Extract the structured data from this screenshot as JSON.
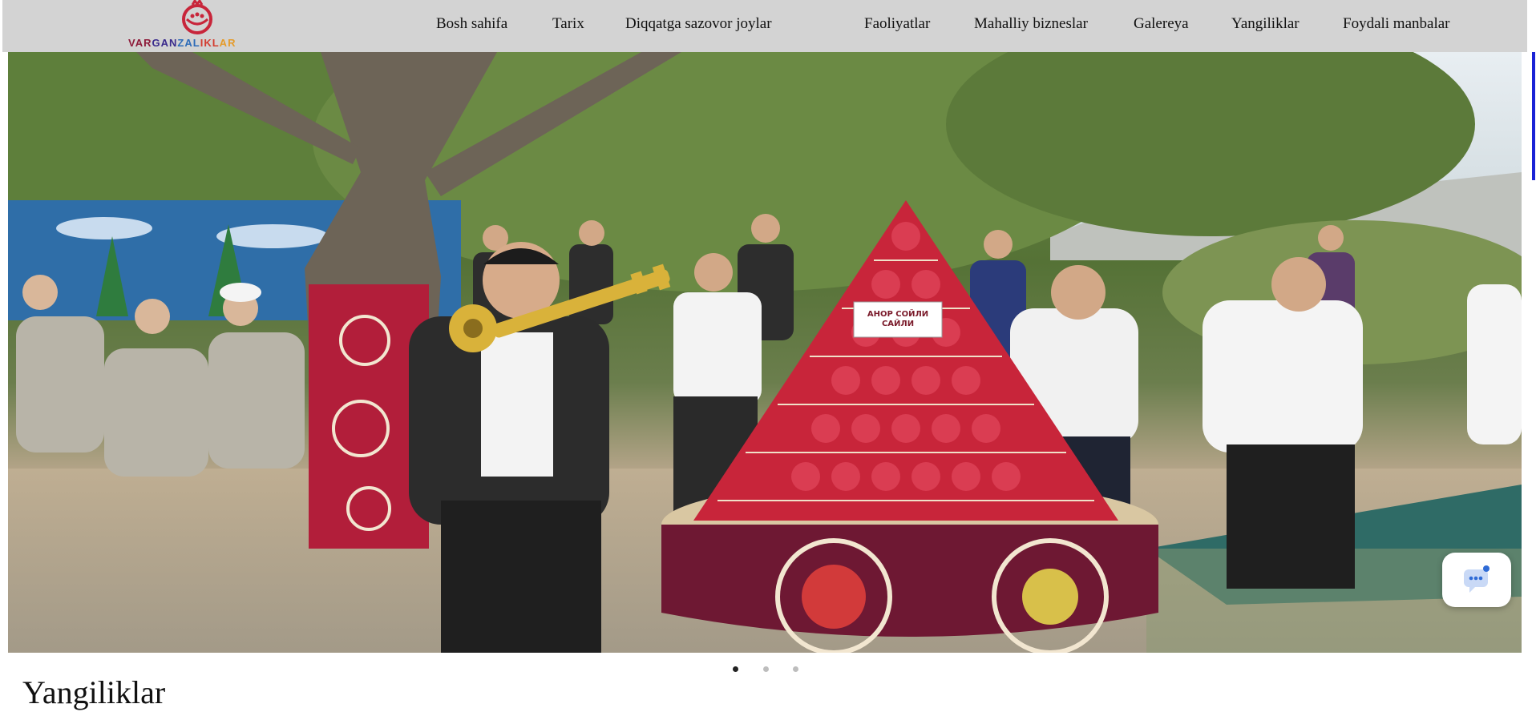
{
  "brand": {
    "name": "VARGANZALIKLAR",
    "logo_icon": "pomegranate-icon",
    "gradient": [
      "#8e1b3a",
      "#3a2a8c",
      "#2d6bb8",
      "#d33c2f",
      "#e59b2a"
    ]
  },
  "nav": {
    "items": [
      {
        "label": "Bosh sahifa"
      },
      {
        "label": "Tarix"
      },
      {
        "label": "Diqqatga sazovor joylar"
      },
      {
        "label": "Faoliyatlar"
      },
      {
        "label": "Mahalliy bizneslar"
      },
      {
        "label": "Galereya"
      },
      {
        "label": "Yangiliklar"
      },
      {
        "label": "Foydali manbalar"
      }
    ]
  },
  "hero": {
    "image_alt": "Festival photo with pomegranate pyramid",
    "sign_text": "АНОР СОЙЛИ САЙЛИ"
  },
  "carousel": {
    "slides": 3,
    "active": 1
  },
  "chat": {
    "icon": "chat-bubble-icon",
    "accent": "#2f6bd6"
  },
  "section": {
    "title": "Yangiliklar"
  },
  "colors": {
    "nav_bg": "#d3d3d3",
    "scroll_accent": "#1a22d6",
    "dot_active": "#222222",
    "dot_inactive": "#bdbdbd",
    "pomegranate_red": "#c8253a"
  }
}
